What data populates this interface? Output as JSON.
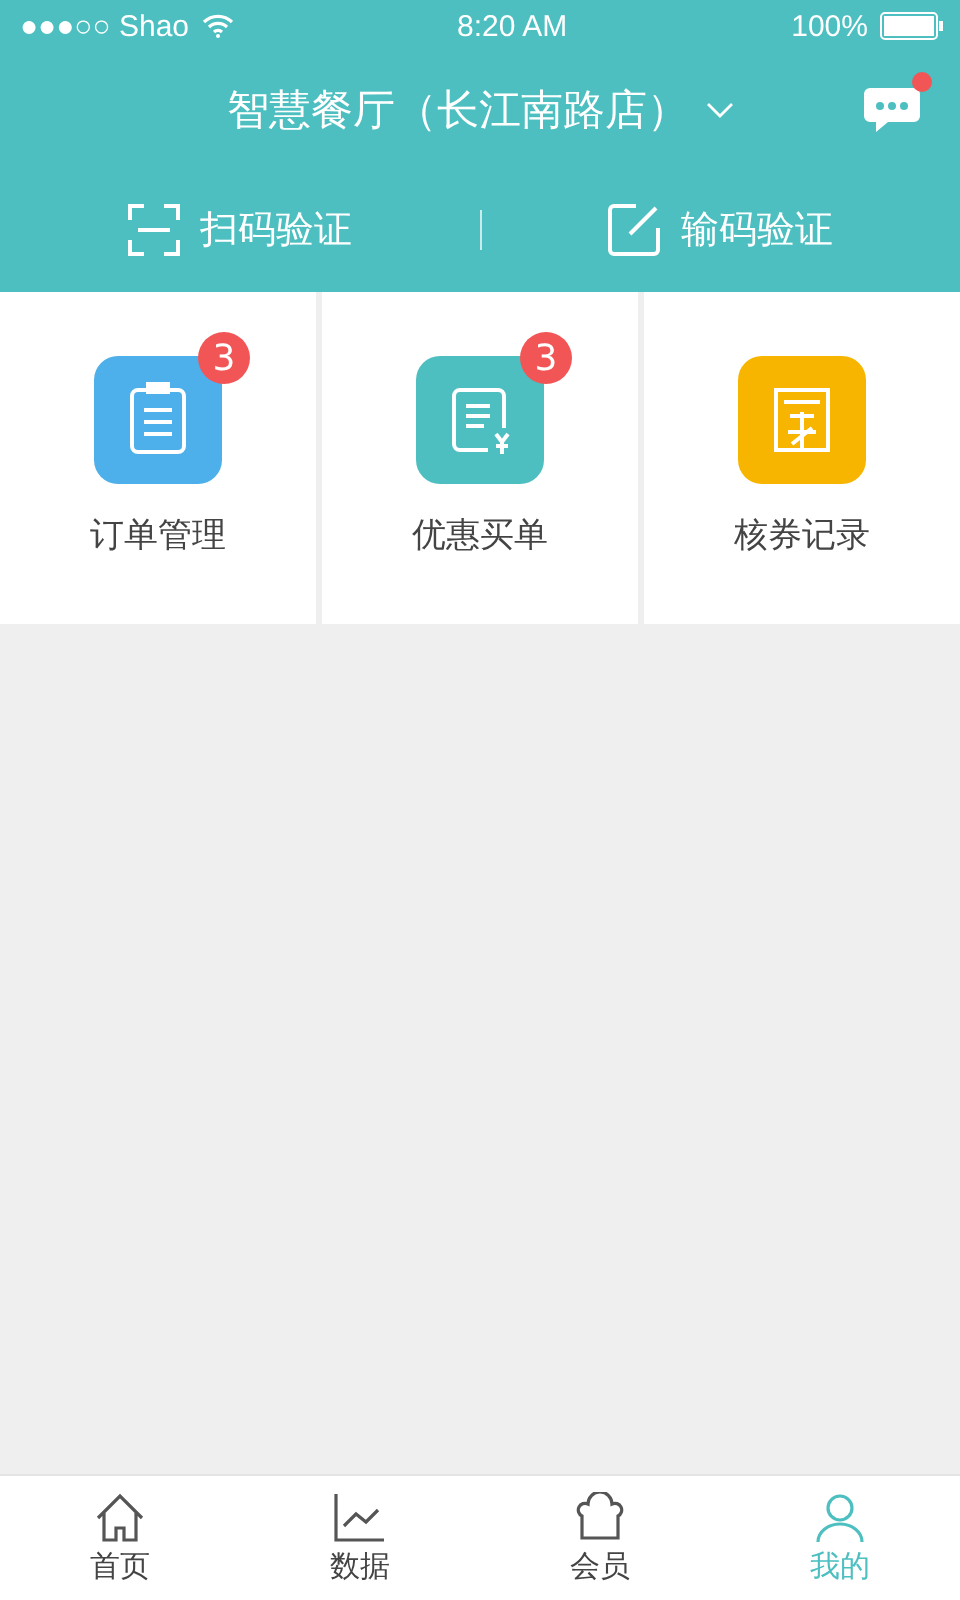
{
  "status_bar": {
    "carrier": "●●●○○ Shao",
    "time": "8:20 AM",
    "battery": "100%"
  },
  "header": {
    "title": "智慧餐厅（长江南路店）",
    "has_unread": true
  },
  "actions": [
    {
      "kind": "scan",
      "label": "扫码验证"
    },
    {
      "kind": "input",
      "label": "输码验证"
    }
  ],
  "tiles": [
    {
      "kind": "orders",
      "label": "订单管理",
      "badge": "3",
      "color": "#4db0ea"
    },
    {
      "kind": "discount",
      "label": "优惠买单",
      "badge": "3",
      "color": "#4dbfc0"
    },
    {
      "kind": "coupon",
      "label": "核券记录",
      "color": "#f7b500"
    }
  ],
  "tabs": [
    {
      "kind": "home",
      "label": "首页",
      "selected": false
    },
    {
      "kind": "data",
      "label": "数据",
      "selected": false
    },
    {
      "kind": "member",
      "label": "会员",
      "selected": false
    },
    {
      "kind": "me",
      "label": "我的",
      "selected": true
    }
  ]
}
